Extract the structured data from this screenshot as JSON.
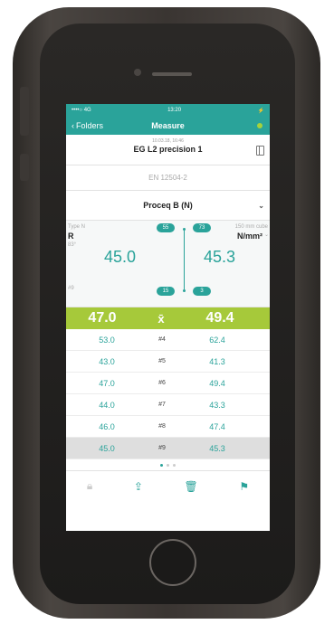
{
  "status": {
    "carrier": "••••○ 4G",
    "time": "13:20",
    "battery": "⚡"
  },
  "nav": {
    "back_label": "Folders",
    "title": "Measure"
  },
  "header": {
    "date": "10.03.18, 16:46",
    "name": "EG L2 precision 1"
  },
  "standard": "EN 12504-2",
  "selector": {
    "value": "Proceq B (N)"
  },
  "measurement": {
    "type_label": "Type N",
    "type_value": "R",
    "angle": "83°",
    "count": "#9",
    "left_value": "45.0",
    "right_value": "45.3",
    "unit_label": "150 mm cube",
    "unit": "N/mm²",
    "pill_top_left": "55",
    "pill_top_right": "73",
    "pill_bottom_left": "15",
    "pill_bottom_right": "3"
  },
  "average": {
    "left": "47.0",
    "symbol": "x̄",
    "right": "49.4"
  },
  "rows": [
    {
      "left": "53.0",
      "id": "#4",
      "right": "62.4"
    },
    {
      "left": "43.0",
      "id": "#5",
      "right": "41.3"
    },
    {
      "left": "47.0",
      "id": "#6",
      "right": "49.4"
    },
    {
      "left": "44.0",
      "id": "#7",
      "right": "43.3"
    },
    {
      "left": "46.0",
      "id": "#8",
      "right": "47.4"
    },
    {
      "left": "45.0",
      "id": "#9",
      "right": "45.3"
    }
  ],
  "colors": {
    "accent": "#2aa39a",
    "avg_bar": "#a6c93a"
  }
}
